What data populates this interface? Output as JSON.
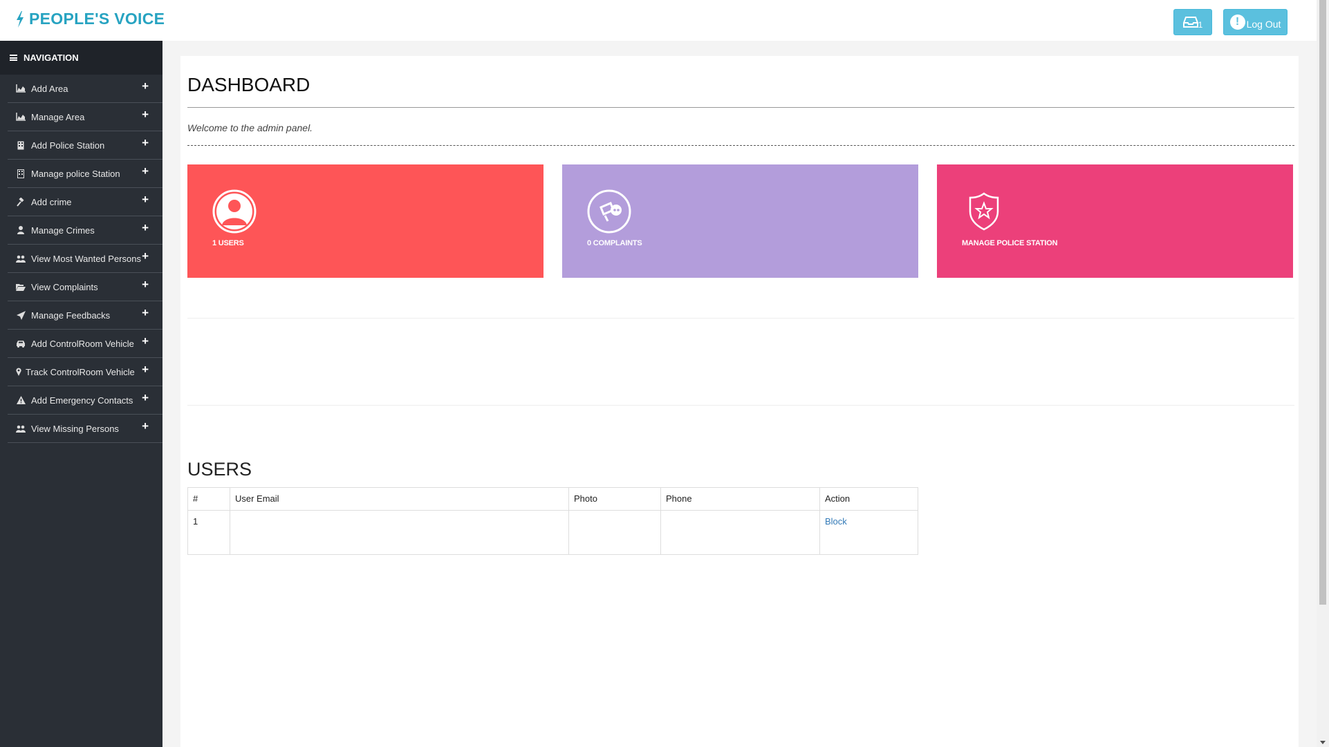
{
  "brand": {
    "title": "PEOPLE'S VOICE"
  },
  "header": {
    "inbox_count": "1",
    "logout_label": "Log Out"
  },
  "sidebar": {
    "heading": "NAVIGATION",
    "items": [
      {
        "label": "Add Area",
        "icon": "area-chart-icon"
      },
      {
        "label": "Manage Area",
        "icon": "area-chart-icon"
      },
      {
        "label": "Add Police Station",
        "icon": "building-icon"
      },
      {
        "label": "Manage police Station",
        "icon": "building-icon"
      },
      {
        "label": "Add crime",
        "icon": "gavel-icon"
      },
      {
        "label": "Manage Crimes",
        "icon": "user-icon"
      },
      {
        "label": "View Most Wanted Persons",
        "icon": "users-icon"
      },
      {
        "label": "View Complaints",
        "icon": "folder-open-icon"
      },
      {
        "label": "Manage Feedbacks",
        "icon": "paper-plane-icon"
      },
      {
        "label": "Add ControlRoom Vehicle",
        "icon": "car-icon"
      },
      {
        "label": "Track ControlRoom Vehicle",
        "icon": "map-marker-icon"
      },
      {
        "label": "Add Emergency Contacts",
        "icon": "warning-icon"
      },
      {
        "label": "View Missing Persons",
        "icon": "users-icon"
      }
    ],
    "plus": "+"
  },
  "main": {
    "title": "DASHBOARD",
    "welcome": "Welcome to the admin panel.",
    "cards": [
      {
        "label": "1 USERS",
        "color": "#fe5557",
        "icon": "user-circle-icon"
      },
      {
        "label": "0 COMPLAINTS",
        "color": "#b39ddb",
        "icon": "complaint-icon"
      },
      {
        "label": "MANAGE POLICE STATION",
        "color": "#ec407a",
        "icon": "police-badge-icon"
      }
    ]
  },
  "users": {
    "title": "USERS",
    "columns": [
      "#",
      "User Email",
      "Photo",
      "Phone",
      "Action"
    ],
    "rows": [
      {
        "index": "1",
        "email": "",
        "photo": "",
        "phone": "",
        "action": "Block"
      }
    ]
  },
  "colors": {
    "brand": "#27a3c1",
    "button": "#5bc0de",
    "sidebar": "#2a2f36"
  }
}
